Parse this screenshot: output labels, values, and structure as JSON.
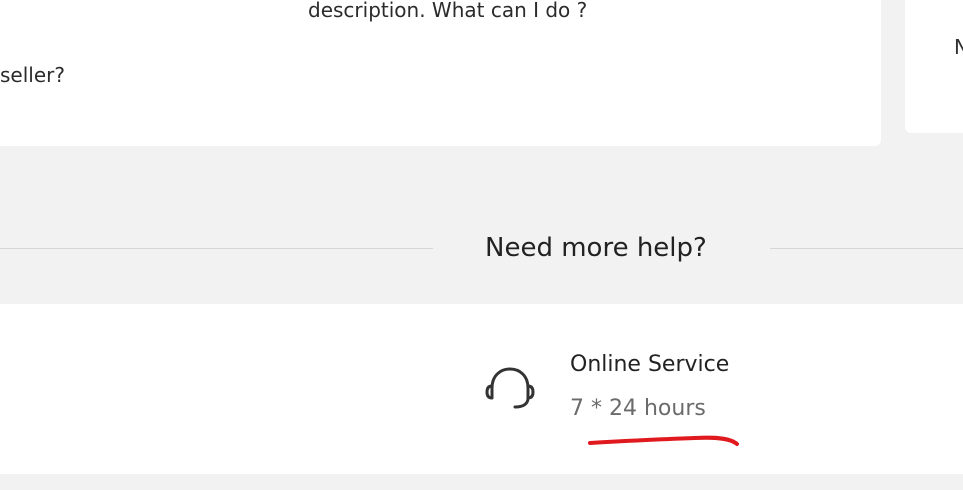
{
  "faq": {
    "question_fragment_1": "description. What can I do ?",
    "question_fragment_2": "seller?"
  },
  "side_card": {
    "fragment": "N"
  },
  "help": {
    "title": "Need more help?"
  },
  "service": {
    "icon": "headset-icon",
    "title": "Online Service",
    "hours": "7 * 24 hours"
  },
  "colors": {
    "background": "#f2f2f2",
    "card": "#ffffff",
    "annotation_stroke": "#e0191e"
  }
}
